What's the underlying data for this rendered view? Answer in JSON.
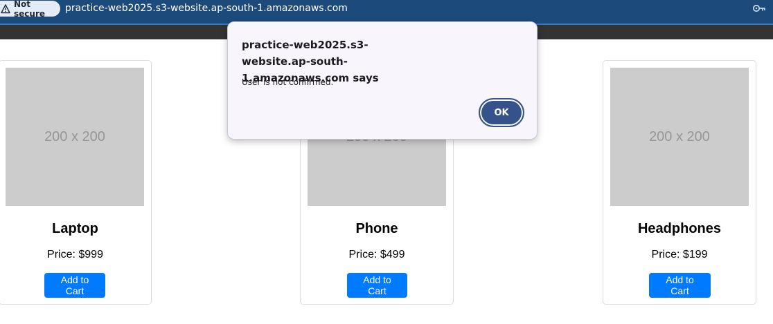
{
  "browser": {
    "security_label": "Not secure",
    "url": "practice-web2025.s3-website.ap-south-1.amazonaws.com",
    "security_icon": "warning-triangle-icon",
    "key_icon": "password-key-icon"
  },
  "products": [
    {
      "image_placeholder": "200 x 200",
      "name": "Laptop",
      "price": "Price: $999",
      "button_label": "Add to Cart"
    },
    {
      "image_placeholder": "200 x 200",
      "name": "Phone",
      "price": "Price: $499",
      "button_label": "Add to Cart"
    },
    {
      "image_placeholder": "200 x 200",
      "name": "Headphones",
      "price": "Price: $199",
      "button_label": "Add to Cart"
    }
  ],
  "alert": {
    "title": "practice-web2025.s3-website.ap-south-1.amazonaws.com says",
    "message": "User is not confirmed.",
    "ok_label": "OK"
  },
  "colors": {
    "address_bar": "#1c4a7a",
    "navbar": "#333333",
    "button_primary": "#007bff",
    "dialog_ok": "#35538a",
    "placeholder_bg": "#cccccc"
  }
}
